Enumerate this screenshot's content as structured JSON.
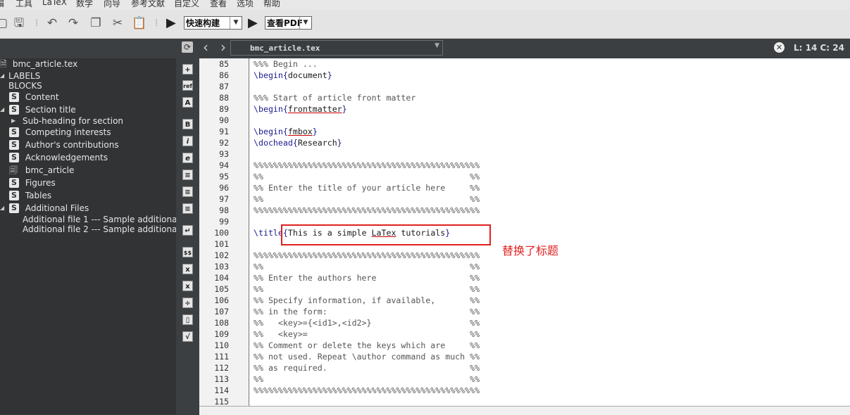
{
  "menu": [
    "编",
    "工具",
    "LaTeX",
    "数学",
    "向导",
    "参考文献",
    "自定义",
    "查看",
    "选项",
    "帮助"
  ],
  "toolbar": {
    "build_label": "快速构建",
    "view_label": "查看PDF"
  },
  "tabbar": {
    "file_name": "bmc_article.tex",
    "cursor": "L: 14 C: 24"
  },
  "structure": {
    "root": "bmc_article.tex",
    "labels": "LABELS",
    "blocks": "BLOCKS",
    "items": [
      {
        "label": "Content",
        "icon": "S"
      },
      {
        "label": "Section title",
        "icon": "S"
      },
      {
        "label": "Sub-heading for section",
        "icon": ""
      },
      {
        "label": "Competing interests",
        "icon": "S"
      },
      {
        "label": "Author's contributions",
        "icon": "S"
      },
      {
        "label": "Acknowledgements",
        "icon": "S"
      },
      {
        "label": "bmc_article",
        "icon": "file"
      },
      {
        "label": "Figures",
        "icon": "S"
      },
      {
        "label": "Tables",
        "icon": "S"
      },
      {
        "label": "Additional Files",
        "icon": "S"
      },
      {
        "label": "Additional file 1 --- Sample additional file",
        "icon": ""
      },
      {
        "label": "Additional file 2 --- Sample additional file",
        "icon": ""
      }
    ]
  },
  "palette": [
    "+",
    "ref",
    "A",
    "B",
    "i",
    "e",
    "≡",
    "≡",
    "≡",
    "↵",
    "$$",
    "x",
    "x",
    "÷",
    "▯",
    "√"
  ],
  "editor": {
    "line_numbers": [
      "85",
      "86",
      "87",
      "88",
      "89",
      "90",
      "91",
      "92",
      "93",
      "94",
      "95",
      "96",
      "97",
      "98",
      "99",
      "100",
      "101",
      "102",
      "103",
      "104",
      "105",
      "106",
      "107",
      "108",
      "109",
      "110",
      "111",
      "112",
      "113",
      "114",
      "115"
    ],
    "lines": [
      "%%% Begin ...",
      "\\begin{document}",
      "",
      "%%% Start of article front matter",
      "\\begin{frontmatter}",
      "",
      "\\begin{fmbox}",
      "\\dochead{Research}",
      "",
      "%%%%%%%%%%%%%%%%%%%%%%%%%%%%%%%%%%%%%%%%%%%%%%",
      "%%                                          %%",
      "%% Enter the title of your article here     %%",
      "%%                                          %%",
      "%%%%%%%%%%%%%%%%%%%%%%%%%%%%%%%%%%%%%%%%%%%%%%",
      "",
      "\\title{This is a simple LaTex tutorials}",
      "",
      "%%%%%%%%%%%%%%%%%%%%%%%%%%%%%%%%%%%%%%%%%%%%%%",
      "%%                                          %%",
      "%% Enter the authors here                   %%",
      "%%                                          %%",
      "%% Specify information, if available,       %%",
      "%% in the form:                             %%",
      "%%   <key>={<id1>,<id2>}                    %%",
      "%%   <key>=                                 %%",
      "%% Comment or delete the keys which are     %%",
      "%% not used. Repeat \\author command as much %%",
      "%% as required.                             %%",
      "%%                                          %%",
      "%%%%%%%%%%%%%%%%%%%%%%%%%%%%%%%%%%%%%%%%%%%%%%",
      ""
    ]
  },
  "annotation": {
    "text": "替换了标题",
    "color": "#e02020"
  },
  "colors": {
    "keyword": "#1b1b8f",
    "comment": "#555555",
    "panel": "#313335"
  }
}
